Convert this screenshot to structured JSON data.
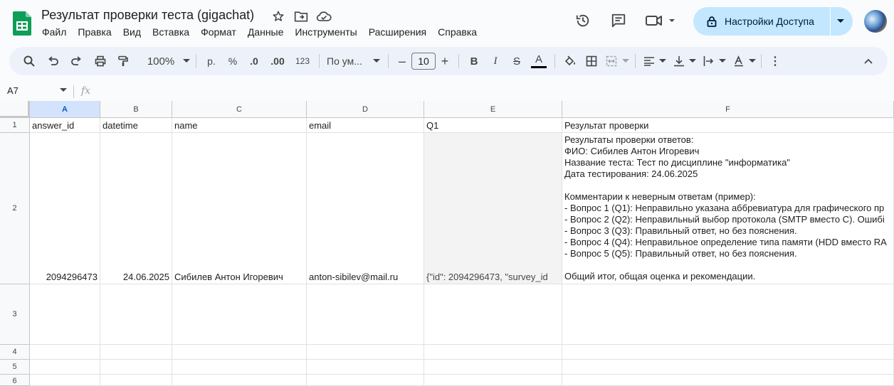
{
  "doc": {
    "title": "Результат проверки теста (gigachat)"
  },
  "menu": [
    "Файл",
    "Правка",
    "Вид",
    "Вставка",
    "Формат",
    "Данные",
    "Инструменты",
    "Расширения",
    "Справка"
  ],
  "share": {
    "label": "Настройки Доступа"
  },
  "toolbar": {
    "zoom": "100%",
    "currency": "р.",
    "percent": "%",
    "dec_less": ".0",
    "dec_more": ".00",
    "number_format": "123",
    "font_name": "По ум...",
    "font_size": "10",
    "bold": "B",
    "italic": "I",
    "text_color_letter": "A",
    "text_color": "#000000"
  },
  "formula": {
    "namebox": "A7",
    "fx": "fx",
    "value": ""
  },
  "columns": [
    "A",
    "B",
    "C",
    "D",
    "E",
    "F"
  ],
  "rows": [
    "1",
    "2",
    "3",
    "4",
    "5",
    "6"
  ],
  "cells": {
    "A1": "answer_id",
    "B1": "datetime",
    "C1": "name",
    "D1": "email",
    "E1": "Q1",
    "F1": "Результат проверки",
    "A2": "2094296473",
    "B2": "24.06.2025",
    "C2": "Сибилев Антон Игоревич",
    "D2": "anton-sibilev@mail.ru",
    "E2": "{\"id\": 2094296473, \"survey_id",
    "F2": "Результаты проверки ответов:\nФИО: Сибилев Антон Игоревич\nНазвание теста: Тест по дисциплине \"информатика\"\nДата тестирования: 24.06.2025\n\nКомментарии к неверным ответам (пример):\n- Вопрос 1 (Q1): Неправильно указана аббревиатура для графического пр\n- Вопрос 2 (Q2): Неправильный выбор протокола (SMTP вместо C). Ошибі\n- Вопрос 3 (Q3): Правильный ответ, но без пояснения.\n- Вопрос 4 (Q4): Неправильное определение типа памяти (HDD вместо RA\n- Вопрос 5 (Q5): Правильный ответ, но без пояснения.\n\nОбщий итог, общая оценка и рекомендации."
  },
  "colors": {
    "accent": "#0b57d0",
    "share_bg": "#c2e7ff",
    "logo_green": "#0f9d58",
    "selected_header": "#d3e3fd"
  }
}
